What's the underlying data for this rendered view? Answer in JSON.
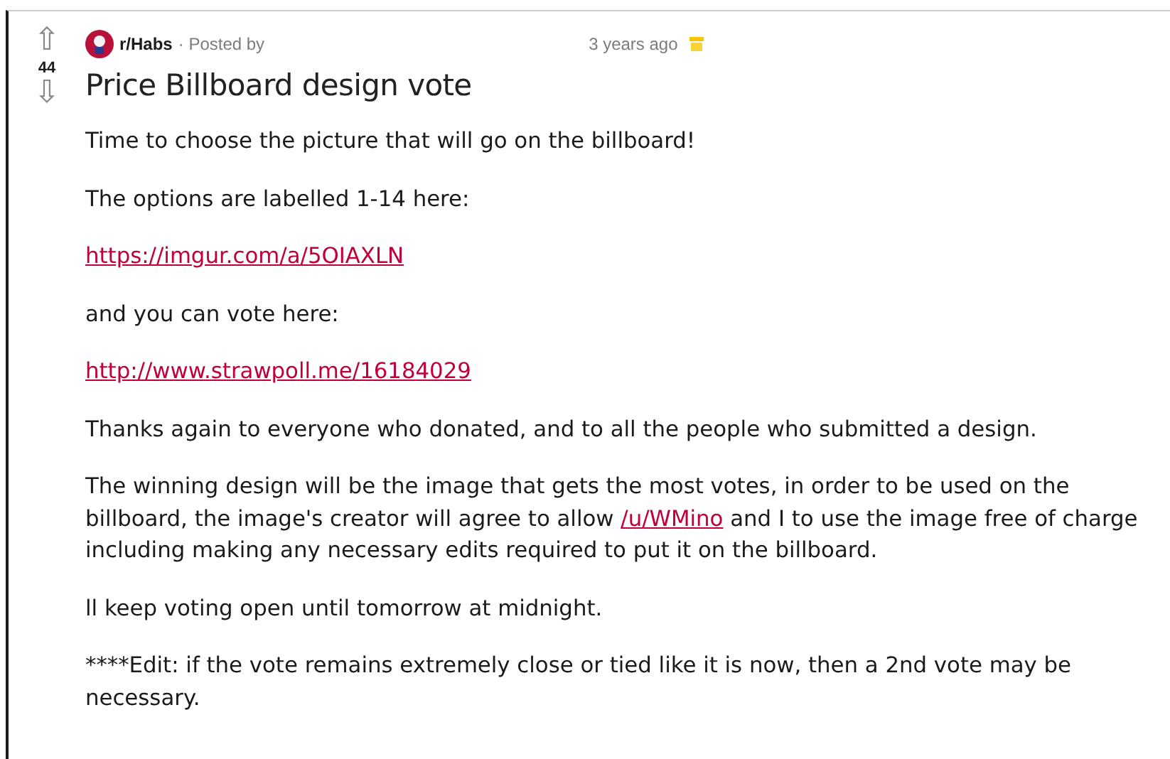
{
  "vote": {
    "up": "⇧",
    "score": "44",
    "down": "⇩"
  },
  "post": {
    "subreddit": "r/Habs",
    "posted_by": "· Posted by",
    "time": "3 years ago",
    "title": "Price Billboard design vote"
  },
  "body": [
    {
      "kind": "text",
      "parts": [
        {
          "kind": "text",
          "text": "Time to choose the picture that will go on the billboard!"
        }
      ]
    },
    {
      "kind": "text",
      "parts": [
        {
          "kind": "text",
          "text": "The options are labelled 1-14 here:"
        }
      ]
    },
    {
      "kind": "text",
      "parts": [
        {
          "kind": "link",
          "text": "https://imgur.com/a/5OIAXLN"
        }
      ]
    },
    {
      "kind": "text",
      "parts": [
        {
          "kind": "text",
          "text": "and you can vote here:"
        }
      ]
    },
    {
      "kind": "text",
      "parts": [
        {
          "kind": "link",
          "text": "http://www.strawpoll.me/16184029"
        }
      ]
    },
    {
      "kind": "text",
      "parts": [
        {
          "kind": "text",
          "text": "Thanks again to everyone who donated, and to all the people who submitted a design."
        }
      ]
    },
    {
      "kind": "text",
      "parts": [
        {
          "kind": "text",
          "text": "The winning design will be the image that gets the most votes, in order to be used on the\nbillboard, the image's creator will agree to allow "
        },
        {
          "kind": "link",
          "text": "/u/WMino"
        },
        {
          "kind": "text",
          "text": " and I to use the image free of charge\nincluding making any necessary edits required to put it on the billboard."
        }
      ]
    },
    {
      "kind": "text",
      "parts": [
        {
          "kind": "text",
          "text": "ll keep voting open until tomorrow at midnight."
        }
      ]
    },
    {
      "kind": "text",
      "parts": [
        {
          "kind": "text",
          "text": "****Edit: if the vote remains extremely close or tied like it is now, then a 2nd vote may be\nnecessary."
        }
      ]
    }
  ]
}
